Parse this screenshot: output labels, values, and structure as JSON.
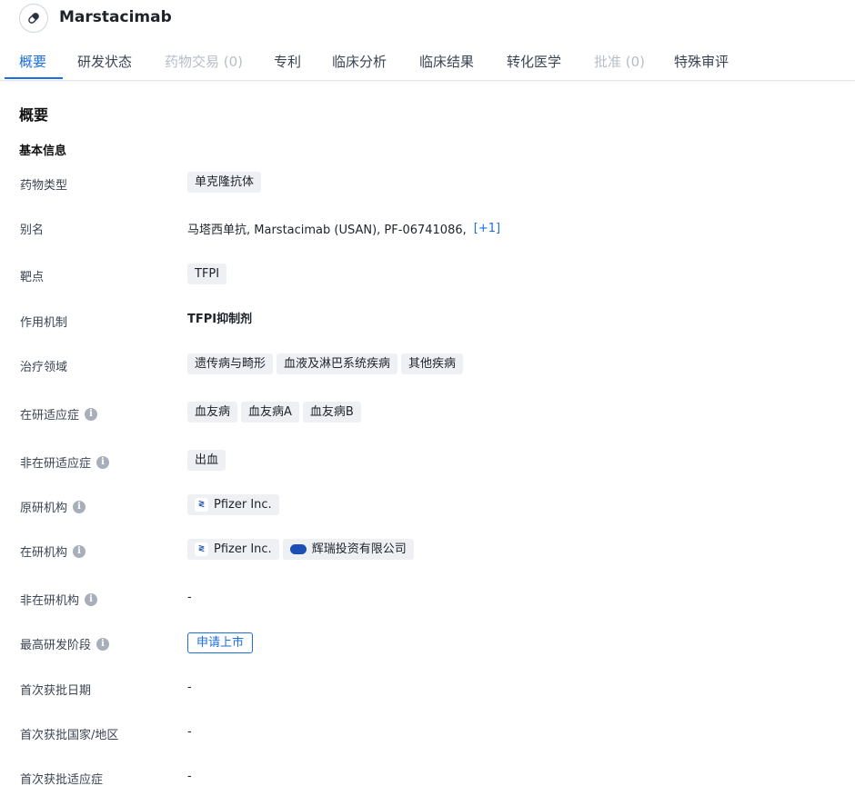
{
  "header": {
    "drug_name": "Marstacimab",
    "icon": "pill-icon"
  },
  "tabs": [
    {
      "label": "概要",
      "state": "active"
    },
    {
      "label": "研发状态",
      "state": "normal"
    },
    {
      "label": "药物交易 (0)",
      "state": "disabled"
    },
    {
      "label": "专利",
      "state": "normal"
    },
    {
      "label": "临床分析",
      "state": "normal"
    },
    {
      "label": "临床结果",
      "state": "normal"
    },
    {
      "label": "转化医学",
      "state": "normal"
    },
    {
      "label": "批准 (0)",
      "state": "disabled"
    },
    {
      "label": "特殊审评",
      "state": "normal"
    }
  ],
  "overview": {
    "section_title": "概要",
    "basic_info_title": "基本信息",
    "rows": {
      "drug_type": {
        "label": "药物类型",
        "tags": [
          "单克隆抗体"
        ]
      },
      "alias": {
        "label": "别名",
        "text": "马塔西单抗,  Marstacimab (USAN),  PF-06741086,",
        "more": "[+1]"
      },
      "target": {
        "label": "靶点",
        "tags": [
          "TFPI"
        ]
      },
      "mechanism": {
        "label": "作用机制",
        "text": "TFPI抑制剂"
      },
      "therapeutic_area": {
        "label": "治疗领域",
        "tags": [
          "遗传病与畸形",
          "血液及淋巴系统疾病",
          "其他疾病"
        ]
      },
      "active_indication": {
        "label": "在研适应症",
        "tags": [
          "血友病",
          "血友病A",
          "血友病B"
        ]
      },
      "inactive_indication": {
        "label": "非在研适应症",
        "tags": [
          "出血"
        ]
      },
      "originator": {
        "label": "原研机构",
        "orgs": [
          "Pfizer Inc."
        ]
      },
      "active_org": {
        "label": "在研机构",
        "orgs": [
          "Pfizer Inc.",
          "辉瑞投资有限公司"
        ]
      },
      "inactive_org": {
        "label": "非在研机构",
        "text": "-"
      },
      "highest_phase": {
        "label": "最高研发阶段",
        "stage": "申请上市"
      },
      "first_approval_date": {
        "label": "首次获批日期",
        "text": "-"
      },
      "first_approval_country": {
        "label": "首次获批国家/地区",
        "text": "-"
      },
      "first_approval_indication": {
        "label": "首次获批适应症",
        "text": "-"
      }
    }
  },
  "colors": {
    "accent": "#1b6fe0",
    "tag_bg": "#eef0f4",
    "disabled": "#b7bdc7"
  }
}
